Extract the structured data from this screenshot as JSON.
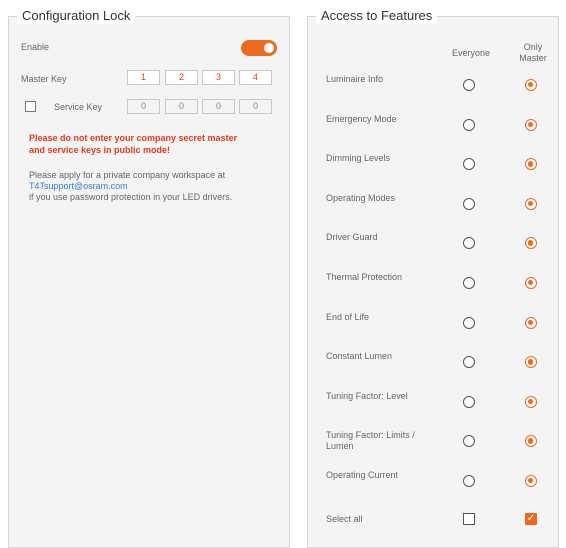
{
  "config_lock": {
    "title": "Configuration Lock",
    "enable_label": "Enable",
    "enable_on": true,
    "master_key_label": "Master Key",
    "master_key": [
      "1",
      "2",
      "3",
      "4"
    ],
    "service_key_label": "Service Key",
    "service_key_checked": false,
    "service_key": [
      "0",
      "0",
      "0",
      "0"
    ],
    "warning_line1": "Please do not enter your company secret master",
    "warning_line2": "and service keys in public mode!",
    "info_line1": "Please apply for a private company workspace at",
    "info_link": "T4Tsupport@osram.com",
    "info_line2": "if you use password protection in your LED drivers."
  },
  "access": {
    "title": "Access to Features",
    "col_everyone": "Everyone",
    "col_only_master": "Only Master",
    "rows": [
      {
        "label": "Luminaire Info",
        "selected": "only_master"
      },
      {
        "label": "Emergency Mode",
        "selected": "only_master"
      },
      {
        "label": "Dimming Levels",
        "selected": "only_master"
      },
      {
        "label": "Operating Modes",
        "selected": "only_master"
      },
      {
        "label": "Driver Guard",
        "selected": "only_master"
      },
      {
        "label": "Thermal Protection",
        "selected": "only_master"
      },
      {
        "label": "End of Life",
        "selected": "only_master"
      },
      {
        "label": "Constant Lumen",
        "selected": "only_master"
      },
      {
        "label": "Tuning Factor: Level",
        "selected": "only_master"
      },
      {
        "label": "Tuning Factor: Limits / Lumen",
        "selected": "only_master"
      },
      {
        "label": "Operating Current",
        "selected": "only_master"
      }
    ],
    "select_all_label": "Select all",
    "select_all_everyone": false,
    "select_all_only_master": true
  },
  "colors": {
    "accent": "#ec6b24",
    "warning": "#e23a20",
    "link": "#3a7bd5"
  }
}
